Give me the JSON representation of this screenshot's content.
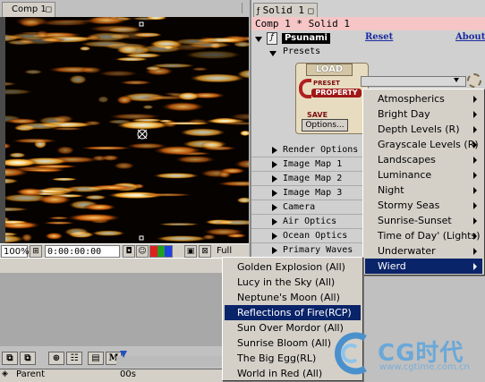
{
  "comp_window": {
    "tab_label": "Comp 1",
    "statusbar": {
      "zoom": "100%",
      "timecode": "0:00:00:00",
      "resolution": "Full"
    }
  },
  "effect_controls": {
    "tab_label": "Solid 1",
    "title": "Comp 1 * Solid 1",
    "effect_name": "Psunami",
    "reset_label": "Reset",
    "about_label": "About",
    "presets_label": "Presets",
    "load_widget": {
      "load_label": "LOAD",
      "preset_label": "PRESET",
      "property_label": "PROPERTY",
      "save_label": "SAVE",
      "options_label": "Options..."
    },
    "groups": [
      "Render Options",
      "Image Map 1",
      "Image Map 2",
      "Image Map 3",
      "Camera",
      "Air Optics",
      "Ocean Optics",
      "Primary Waves"
    ]
  },
  "preset_menu": {
    "items": [
      "Atmospherics",
      "Bright Day",
      "Depth Levels (R)",
      "Grayscale Levels (R)",
      "Landscapes",
      "Luminance",
      "Night",
      "Stormy Seas",
      "Sunrise-Sunset",
      "Time of Day' (Lights)",
      "Underwater",
      "Wierd"
    ],
    "selected": "Wierd"
  },
  "wierd_submenu": {
    "items": [
      "Golden Explosion (All)",
      "Lucy in the Sky (All)",
      "Neptune's Moon (All)",
      "Reflections of Fire(RCP)",
      "Sun Over Mordor (All)",
      "Sunrise Bloom (All)",
      "The Big Egg(RL)",
      "World in Red (All)"
    ],
    "selected": "Reflections of Fire(RCP)"
  },
  "timeline": {
    "parent_label": "Parent",
    "time_label": "00s"
  },
  "watermark": {
    "logo_text": "CG时代",
    "url": "www.cgtime.com.cn"
  },
  "colors": {
    "menu_highlight": "#0a246a",
    "title_bar_pink": "#f6c6c6",
    "link_blue": "#1a2aa0"
  }
}
